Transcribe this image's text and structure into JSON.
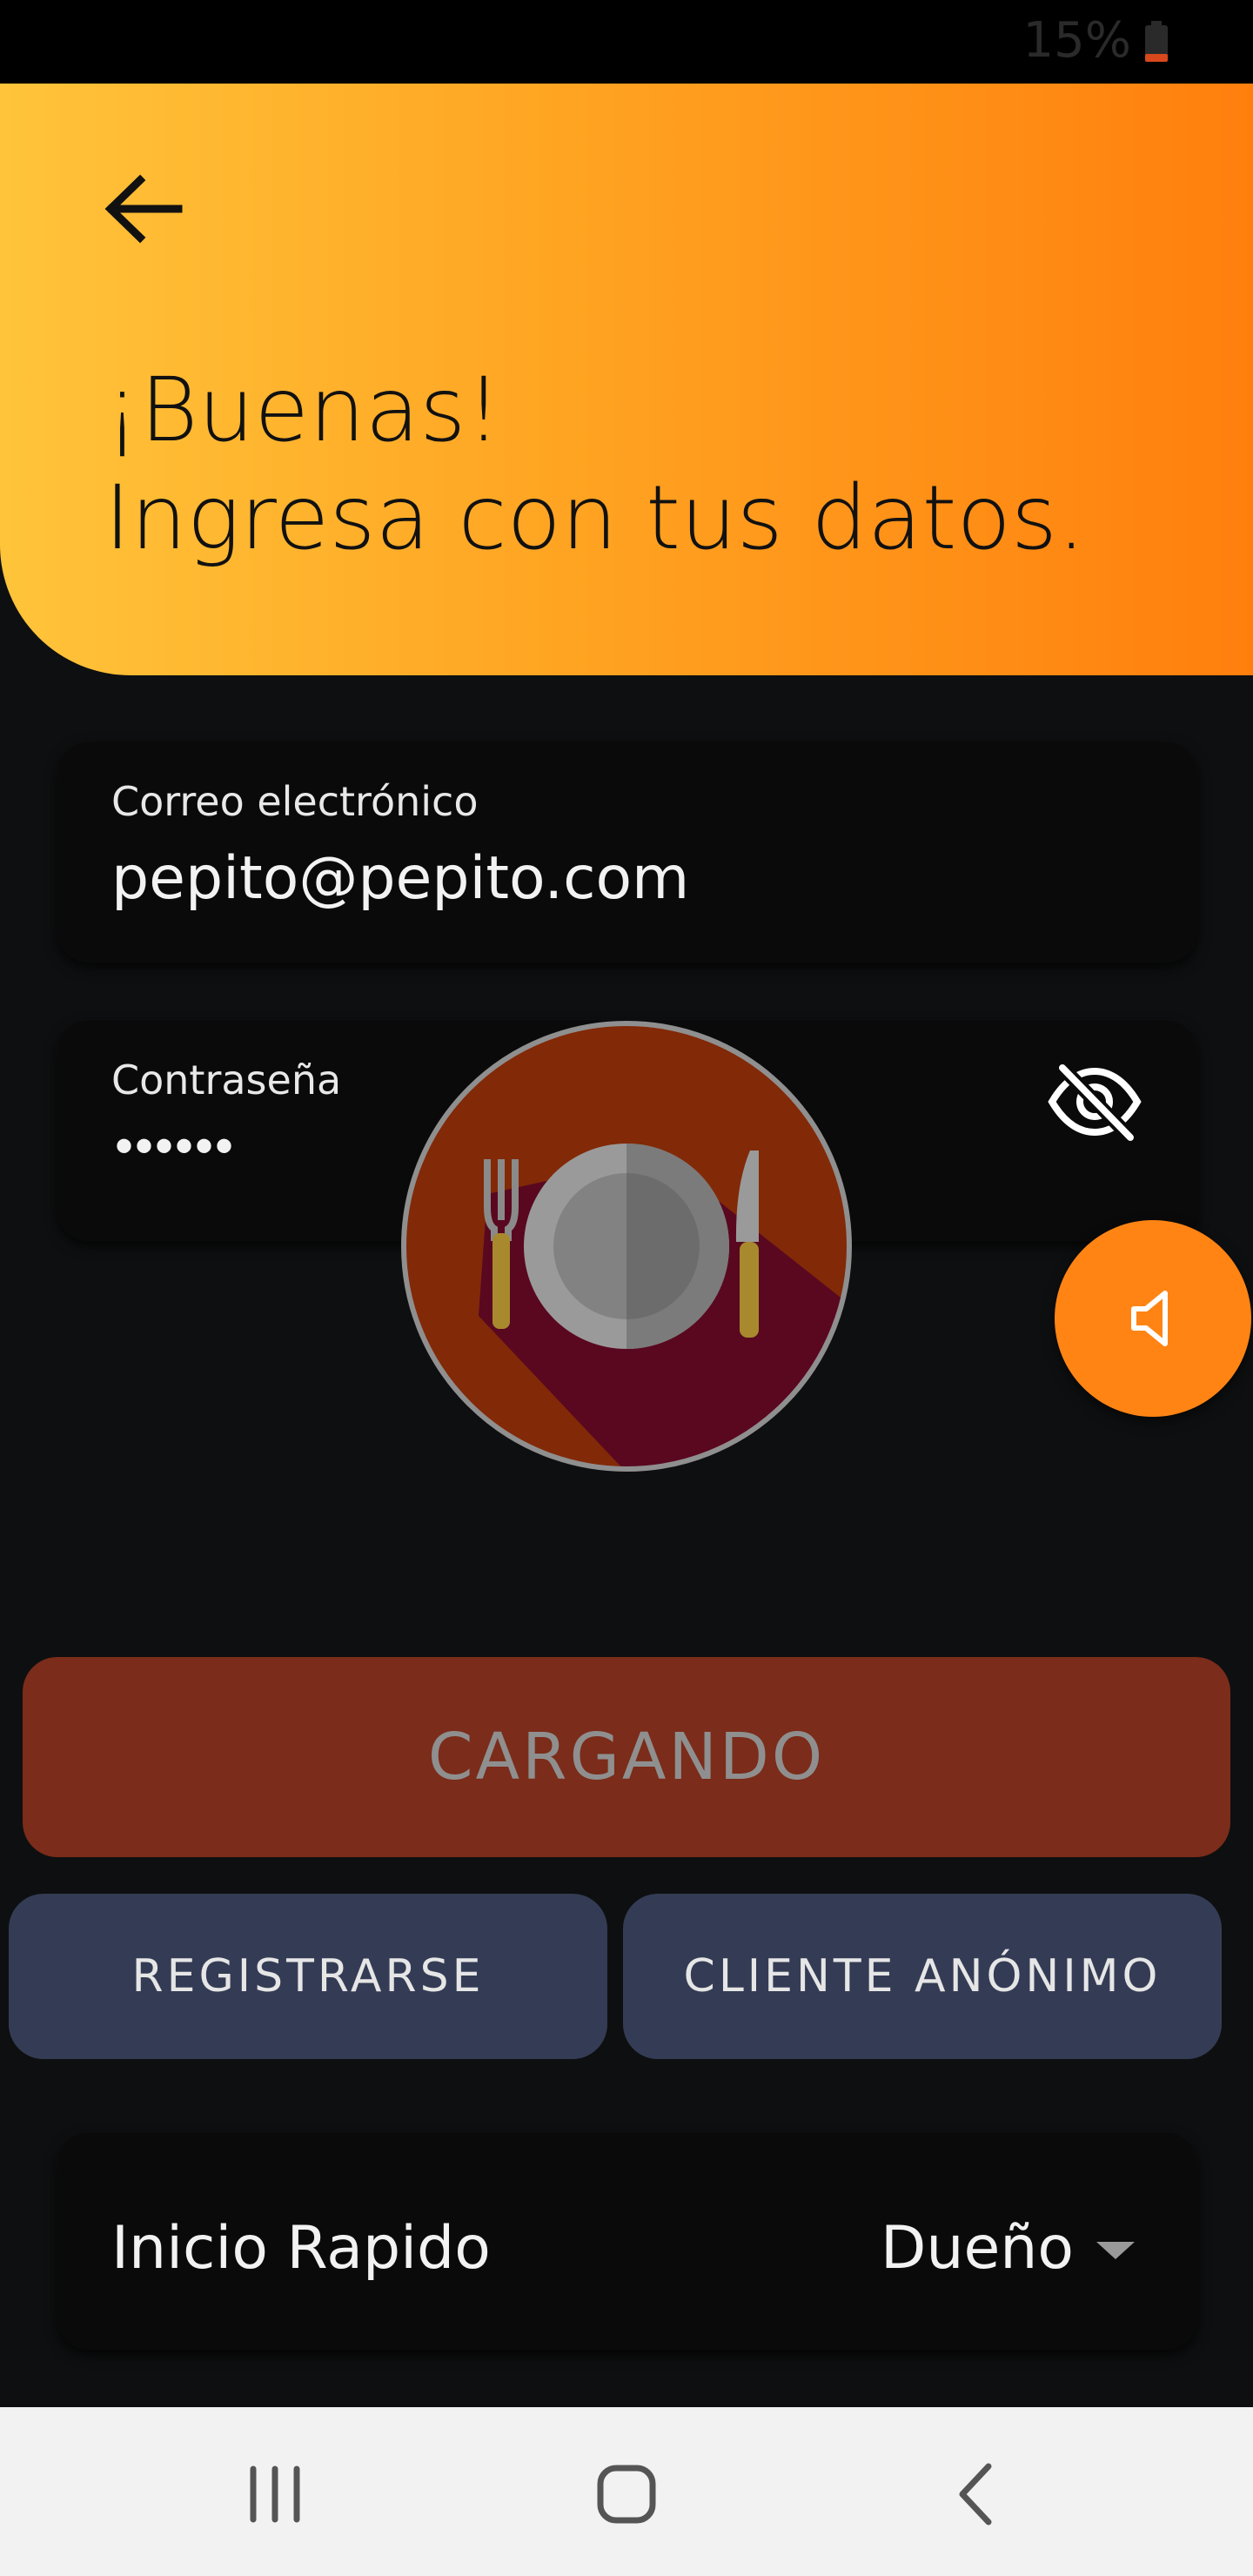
{
  "status_bar": {
    "battery_text": "15%",
    "battery_icon": "battery-low-icon"
  },
  "header": {
    "back_icon": "arrow-left-icon",
    "title_line1": "¡Buenas!",
    "title_line2": "Ingresa con tus datos."
  },
  "form": {
    "email": {
      "label": "Correo electrónico",
      "value": "pepito@pepito.com"
    },
    "password": {
      "label": "Contraseña",
      "value": "••••••",
      "toggle_icon": "eye-off-icon"
    }
  },
  "loader": {
    "icon": "plate-fork-knife-icon"
  },
  "fab": {
    "icon": "speaker-icon"
  },
  "buttons": {
    "primary_label": "CARGANDO",
    "register_label": "REGISTRARSE",
    "anonymous_label": "CLIENTE ANÓNIMO"
  },
  "quick_start": {
    "label": "Inicio Rapido",
    "selected": "Dueño"
  },
  "nav": {
    "recents_icon": "recents-icon",
    "home_icon": "home-icon",
    "back_icon": "back-chevron-icon"
  },
  "colors": {
    "header_start": "#ffc43a",
    "header_end": "#ff7f0d",
    "primary_button": "#7b2c1a",
    "secondary_button": "#343c55",
    "fab": "#ff8414",
    "background": "#0e0f10"
  }
}
